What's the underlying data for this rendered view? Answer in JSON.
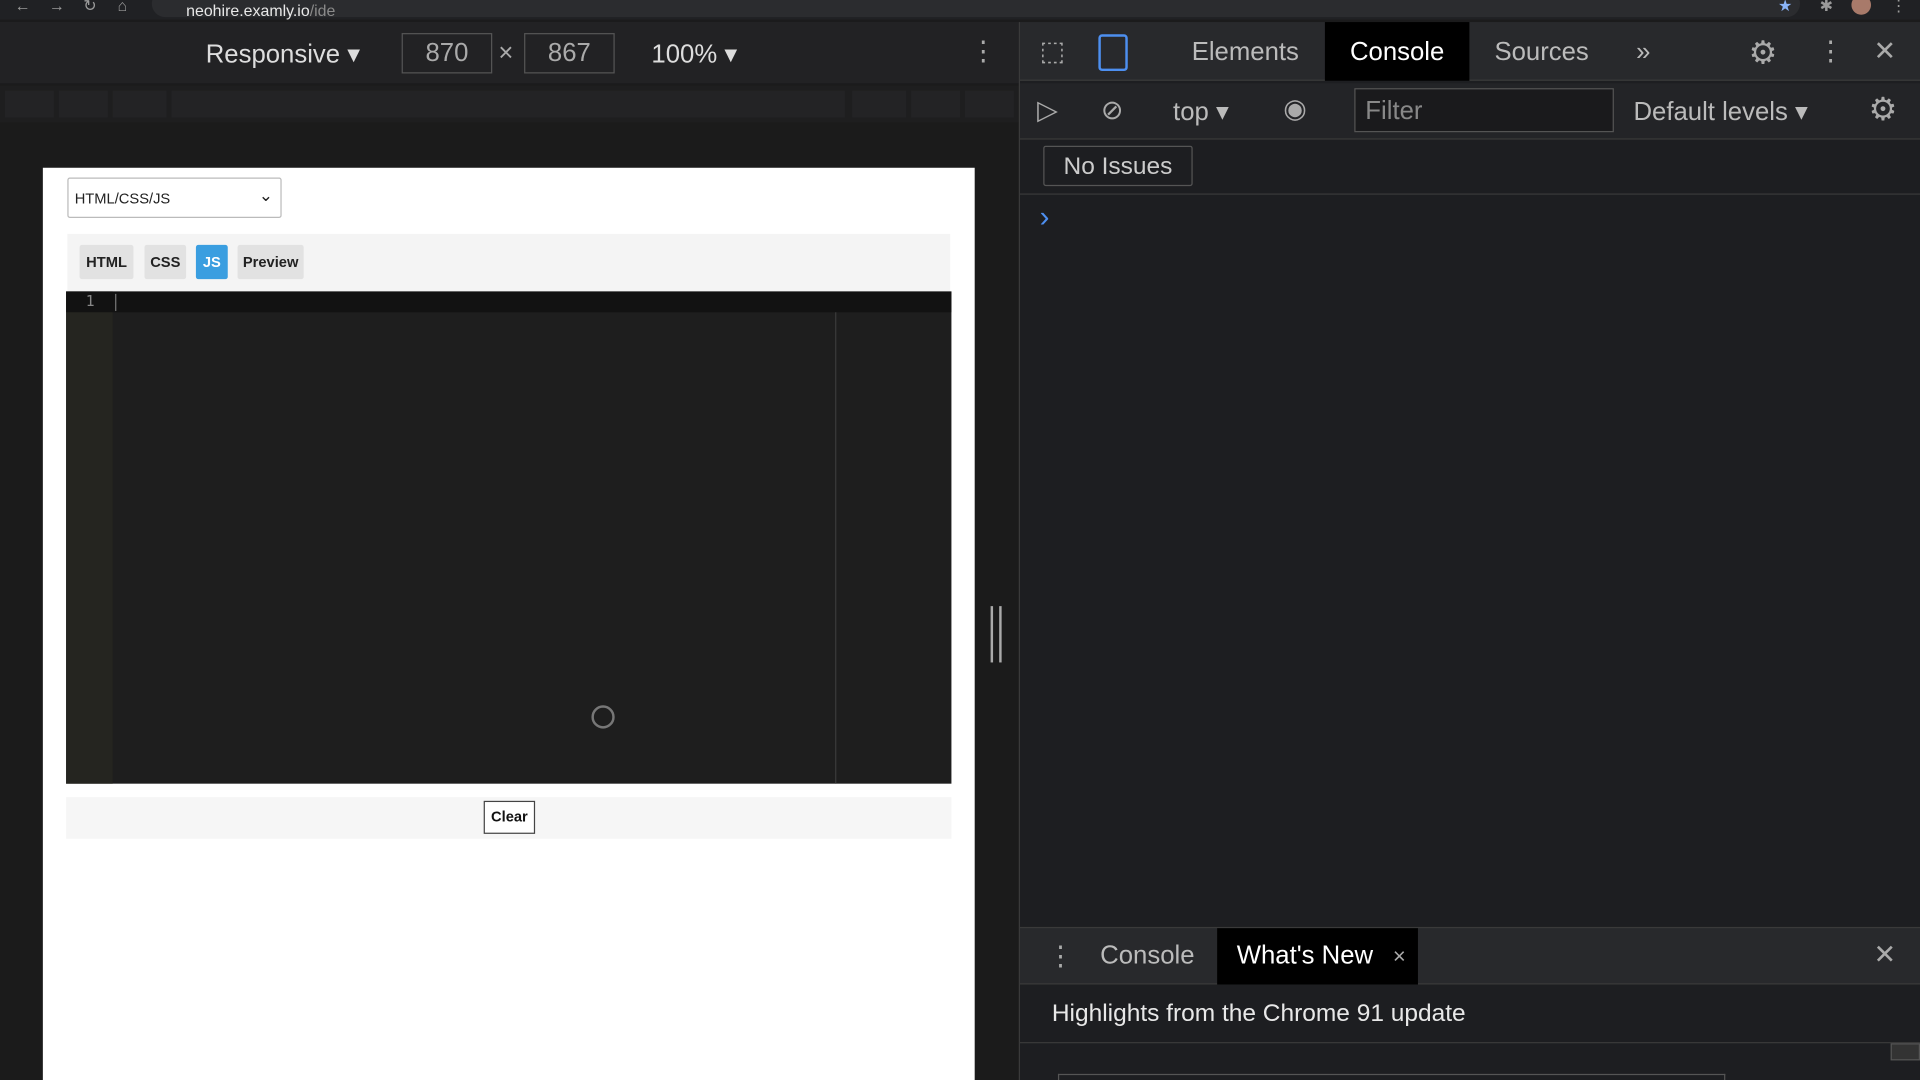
{
  "browser": {
    "url_host": "neohire.examly.io",
    "url_path": "/ide"
  },
  "device_toolbar": {
    "mode": "Responsive",
    "width": "870",
    "height": "867",
    "times": "×",
    "zoom": "100%"
  },
  "page": {
    "language_select": "HTML/CSS/JS",
    "tabs": [
      {
        "label": "HTML"
      },
      {
        "label": "CSS"
      },
      {
        "label": "JS",
        "active": true
      },
      {
        "label": "Preview"
      }
    ],
    "active_color": "#3a9ee0",
    "editor": {
      "line_numbers": [
        "1"
      ],
      "content": ""
    },
    "clear_label": "Clear"
  },
  "devtools": {
    "tabs": [
      {
        "label": "Elements"
      },
      {
        "label": "Console",
        "active": true
      },
      {
        "label": "Sources"
      }
    ],
    "more_tabs": "»",
    "context": "top",
    "filter_placeholder": "Filter",
    "levels": "Default levels",
    "issues": "No Issues",
    "prompt": "›",
    "drawer": {
      "tabs": [
        {
          "label": "Console"
        },
        {
          "label": "What's New",
          "active": true
        }
      ],
      "close": "×",
      "highlights": "Highlights from the Chrome 91 update"
    }
  }
}
